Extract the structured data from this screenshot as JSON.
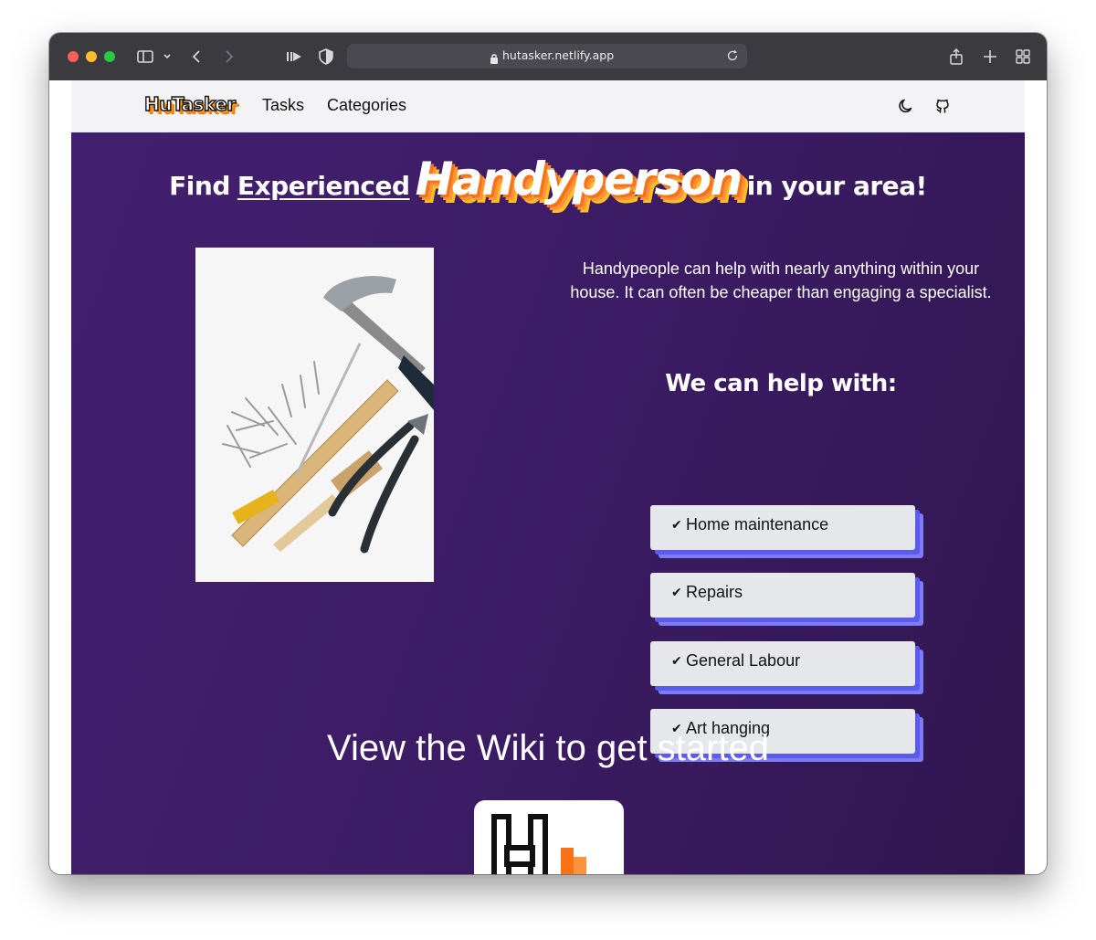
{
  "browser": {
    "url": "hutasker.netlify.app"
  },
  "navbar": {
    "logo": "HuTasker",
    "links": [
      "Tasks",
      "Categories"
    ],
    "theme_icon": "moon-icon",
    "github_icon": "github-icon"
  },
  "hero": {
    "headline": {
      "find": "Find",
      "experienced": "Experienced",
      "highlight": "Handyperson",
      "rest": "in your area!"
    },
    "image_icon": "tools-photo",
    "intro": "Handypeople can help with nearly anything within your house. It can often be cheaper than engaging a specialist.",
    "help_title": "We can help with:",
    "check_mark": "✔",
    "services": [
      "Home maintenance",
      "Repairs",
      "General Labour",
      "Art hanging"
    ]
  },
  "wiki": {
    "cta": "View the Wiki to get started",
    "logo_icon": "hutasker-h-logo"
  },
  "colors": {
    "hero_bg": "#3d1c66",
    "accent_orange": "#f97316",
    "accent_blue": "#5b5bf0",
    "card_bg": "#e5e7eb"
  }
}
